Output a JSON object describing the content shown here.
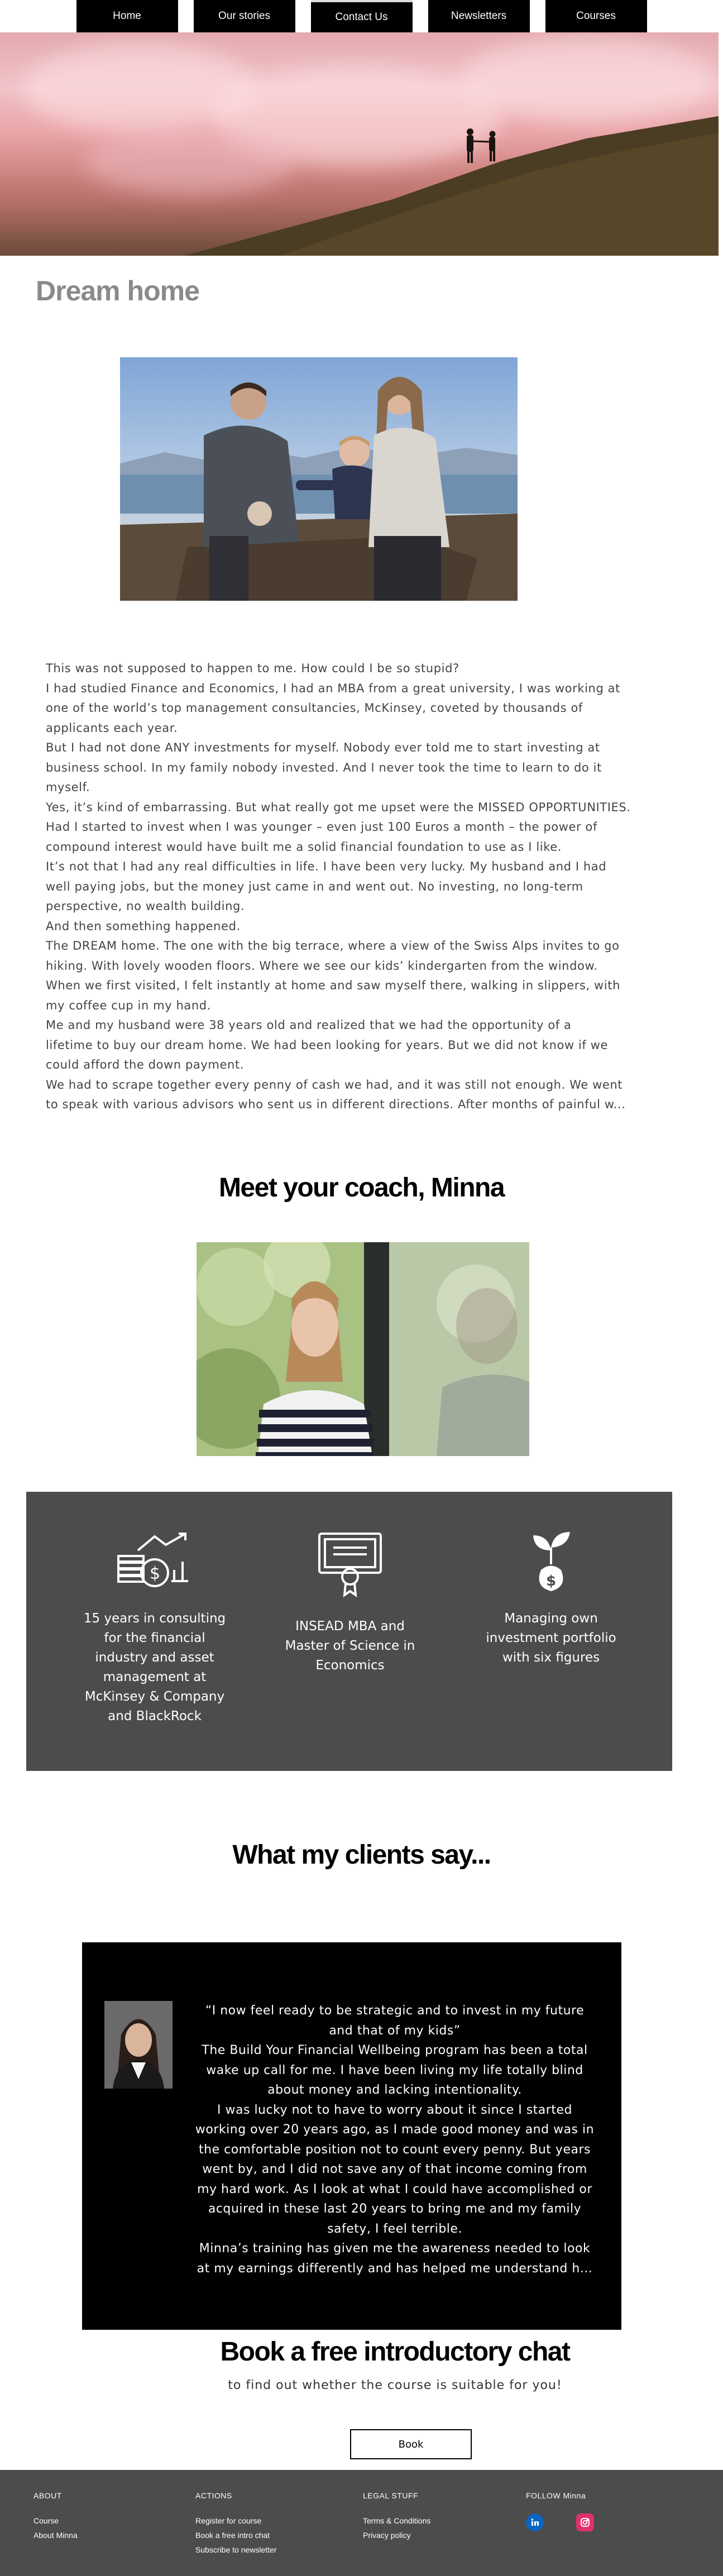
{
  "nav": {
    "items": [
      {
        "label": "Home"
      },
      {
        "label": "Our stories"
      },
      {
        "label": "Contact Us"
      },
      {
        "label": "Newsletters"
      },
      {
        "label": "Courses"
      }
    ]
  },
  "hero": {
    "image": "hero-couple-on-hill-pink-sky"
  },
  "dream": {
    "title": "Dream home",
    "image": "family-photo-lake-mountains",
    "paragraphs": [
      "This was not supposed to happen to me. How could I be so stupid?",
      "I had studied Finance and Economics, I had an MBA from a great university, I was working at",
      "one of the world’s top management consultancies, McKinsey, coveted by thousands of",
      "applicants each year.",
      "But I had not done ANY investments for myself. Nobody ever told me to start investing at",
      "business school. In my family nobody invested. And I never took the time to learn to do it",
      "myself.",
      "Yes, it’s kind of embarrassing. But what really got me upset were the MISSED OPPORTUNITIES.",
      "Had I started to invest when I was younger – even just 100 Euros a month – the power of",
      "compound interest would have built me a solid financial foundation to use as I like.",
      "It’s not that I had any real difficulties in life. I have been very lucky. My husband and I had",
      "well paying jobs, but the money just came in and went out. No investing, no long-term",
      "perspective, no wealth building.",
      "And then something happened.",
      "The DREAM home. The one with the big terrace, where a view of the Swiss Alps invites to go",
      "hiking. With lovely wooden floors. Where we see our kids’ kindergarten from the window.",
      "When we first visited, I felt instantly at home and saw myself there, walking in slippers, with",
      "my coffee cup in my hand.",
      "Me and my husband were 38 years old and realized that we had the opportunity of a",
      "lifetime to buy our dream home. We had been looking for years. But we did not know if we",
      "could afford the down payment.",
      "We had to scrape together every penny of cash we had, and it was still not enough. We went",
      "to speak with various advisors who sent us in different directions. After months of painful w..."
    ]
  },
  "coach": {
    "title": "Meet your coach, Minna",
    "image": "portrait-minna-striped-shirt"
  },
  "stats": [
    {
      "icon": "money-growth-icon",
      "lines": [
        "15 years in consulting",
        "for the financial",
        "industry and asset",
        "management at",
        "McKinsey & Company",
        "and BlackRock"
      ]
    },
    {
      "icon": "certificate-icon",
      "lines": [
        "INSEAD MBA and",
        "Master of Science in",
        "Economics"
      ]
    },
    {
      "icon": "money-plant-icon",
      "lines": [
        "Managing own",
        "investment portfolio",
        "with six figures"
      ]
    }
  ],
  "clients": {
    "title": "What my clients say...",
    "avatar": "client-portrait",
    "quote_lines": [
      "“I now feel ready to be strategic and to invest in my future",
      "and that of my kids”",
      "The Build Your Financial Wellbeing program has been a total",
      "wake up call for me. I have been living my life totally blind",
      "about money and lacking intentionality.",
      "I was lucky not to have to worry about it since I started",
      "working over 20 years ago, as I made good money and was in",
      "the comfortable position not to count every penny. But years",
      "went by, and I did not save any of that income coming from",
      "my hard work. As I look at what I could have accomplished or",
      "acquired in these last 20 years to bring me and my family",
      "safety, I feel terrible.",
      "Minna’s training has given me the awareness needed to look",
      "at my earnings differently and has helped me understand h..."
    ]
  },
  "chat": {
    "title": "Book a free introductory chat",
    "subtitle": "to find out whether the course is suitable for you!",
    "button": "Book"
  },
  "footer": {
    "about": {
      "heading": "ABOUT",
      "links": [
        "Course",
        "About Minna"
      ]
    },
    "actions": {
      "heading": "ACTIONS",
      "links": [
        "Register for course",
        "Book a free intro chat",
        "Subscribe to newsletter"
      ]
    },
    "legal": {
      "heading": "LEGAL STUFF",
      "links": [
        "Terms & Conditions",
        "Privacy policy"
      ]
    },
    "follow": {
      "heading": "FOLLOW Minna",
      "icons": [
        "linkedin-icon",
        "instagram-icon"
      ]
    },
    "colors": {
      "linkedin": "#0a66c2",
      "instagram": "#e1306c"
    }
  }
}
